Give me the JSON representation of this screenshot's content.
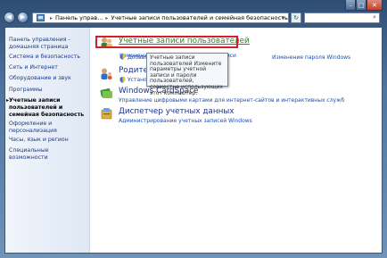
{
  "window": {
    "buttons": {
      "minimize": "–",
      "maximize": "□",
      "close": "✕"
    }
  },
  "nav": {
    "back": "◀",
    "forward": "▶",
    "breadcrumb": [
      "Панель управ...",
      "Учетные записи пользователей и семейная безопасность"
    ],
    "separator": "▸",
    "dropdown": "▾",
    "refresh": "↻",
    "search_icon": "⌕"
  },
  "sidebar": {
    "items": [
      {
        "label": "Панель управления - домашняя страница"
      },
      {
        "label": "Система и безопасность"
      },
      {
        "label": "Сеть и Интернет"
      },
      {
        "label": "Оборудование и звук"
      },
      {
        "label": "Программы"
      },
      {
        "label": "Учетные записи пользователей и семейная безопасность",
        "active": true
      },
      {
        "label": "Оформление и персонализация"
      },
      {
        "label": "Часы, язык и регион"
      },
      {
        "label": "Специальные возможности"
      }
    ]
  },
  "categories": [
    {
      "title": "Учетные записи пользователей",
      "links": [
        "Добавлени",
        "Изменение пароля Windows"
      ],
      "partial": "Изменение изображения учетной записи"
    },
    {
      "title": "Родител",
      "links": [
        "Установ"
      ]
    },
    {
      "title": "Windows CardSpace",
      "links": [
        "Управление цифровыми картами для интернет-сайтов и интерактивных служб"
      ]
    },
    {
      "title": "Диспетчер учетных данных",
      "links": [
        "Администрирование учетных записей Windows"
      ]
    }
  ],
  "tooltip": {
    "text": "Учетные записи пользователей Измените параметры учетной записи и пароли пользователей, совместно использующих этот компьютер."
  },
  "colors": {
    "highlight_box": "#d42027",
    "link": "#1e4eb0",
    "title": "#1e3287",
    "hover_title": "#2a8a1f"
  }
}
